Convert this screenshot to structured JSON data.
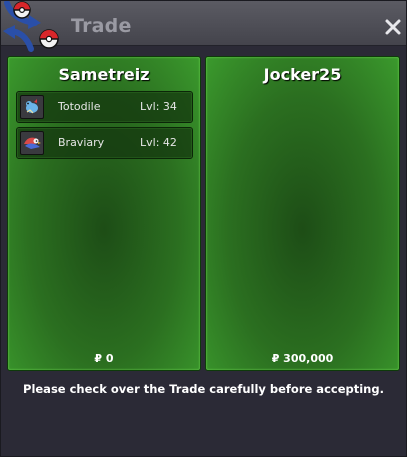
{
  "window": {
    "title": "Trade",
    "close_glyph": "✕"
  },
  "left_panel": {
    "player_name": "Sametreiz",
    "pokemon": [
      {
        "name": "Totodile",
        "level": "Lvl: 34",
        "icon": "totodile-sprite-icon"
      },
      {
        "name": "Braviary",
        "level": "Lvl: 42",
        "icon": "braviary-sprite-icon"
      }
    ],
    "money": "₽ 0"
  },
  "right_panel": {
    "player_name": "Jocker25",
    "pokemon": [],
    "money": "₽ 300,000"
  },
  "footer": {
    "notice": "Please check over the Trade carefully before accepting."
  },
  "colors": {
    "panel_green": "#2b6f20",
    "titlebar": "#4f4f57",
    "background": "#2b2a36"
  }
}
